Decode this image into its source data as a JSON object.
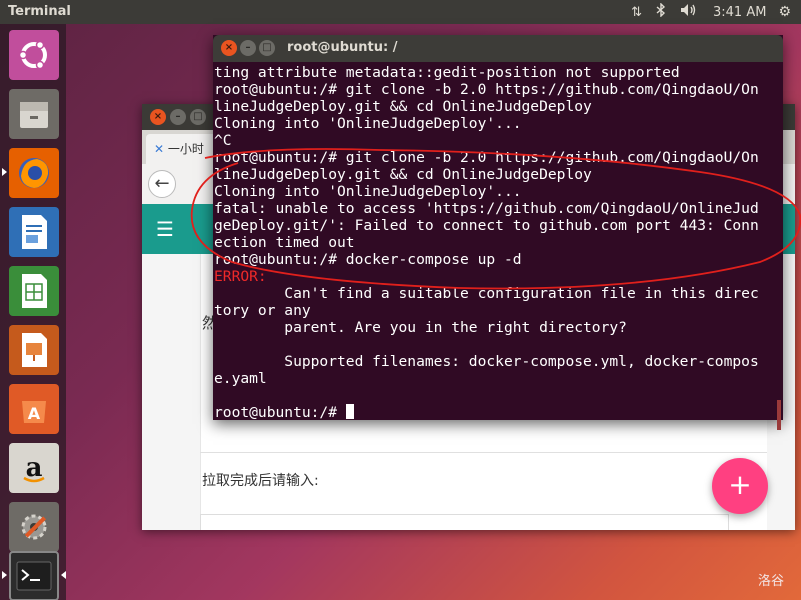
{
  "top_panel": {
    "app_title": "Terminal",
    "clock": "3:41 AM",
    "icons": [
      "network-icon",
      "bluetooth-icon",
      "volume-icon",
      "gear-icon"
    ]
  },
  "launcher": {
    "items": [
      {
        "name": "ubuntu-dash-icon"
      },
      {
        "name": "files-icon"
      },
      {
        "name": "firefox-icon"
      },
      {
        "name": "libreoffice-writer-icon"
      },
      {
        "name": "libreoffice-calc-icon"
      },
      {
        "name": "libreoffice-impress-icon"
      },
      {
        "name": "ubuntu-software-icon"
      },
      {
        "name": "amazon-icon"
      },
      {
        "name": "system-settings-icon"
      },
      {
        "name": "terminal-icon"
      }
    ]
  },
  "browser": {
    "tab_title": "一小时",
    "side_text": "然",
    "pull_text": "拉取完成后请输入:"
  },
  "fab": {
    "label": "+"
  },
  "watermark": "洛谷",
  "terminal": {
    "title": "root@ubuntu: /",
    "lines": [
      {
        "text": "ting attribute metadata::gedit-position not supported",
        "type": "normal"
      },
      {
        "text": "root@ubuntu:/# git clone -b 2.0 https://github.com/QingdaoU/On",
        "type": "normal"
      },
      {
        "text": "lineJudgeDeploy.git && cd OnlineJudgeDeploy",
        "type": "normal"
      },
      {
        "text": "Cloning into 'OnlineJudgeDeploy'...",
        "type": "normal"
      },
      {
        "text": "^C",
        "type": "normal"
      },
      {
        "text": "root@ubuntu:/# git clone -b 2.0 https://github.com/QingdaoU/On",
        "type": "normal"
      },
      {
        "text": "lineJudgeDeploy.git && cd OnlineJudgeDeploy",
        "type": "normal"
      },
      {
        "text": "Cloning into 'OnlineJudgeDeploy'...",
        "type": "normal"
      },
      {
        "text": "fatal: unable to access 'https://github.com/QingdaoU/OnlineJud",
        "type": "normal"
      },
      {
        "text": "geDeploy.git/': Failed to connect to github.com port 443: Conn",
        "type": "normal"
      },
      {
        "text": "ection timed out",
        "type": "normal"
      },
      {
        "text": "root@ubuntu:/# docker-compose up -d",
        "type": "normal"
      },
      {
        "text": "ERROR:",
        "type": "error"
      },
      {
        "text": "        Can't find a suitable configuration file in this direc",
        "type": "normal"
      },
      {
        "text": "tory or any",
        "type": "normal"
      },
      {
        "text": "        parent. Are you in the right directory?",
        "type": "normal"
      },
      {
        "text": "",
        "type": "normal"
      },
      {
        "text": "        Supported filenames: docker-compose.yml, docker-compos",
        "type": "normal"
      },
      {
        "text": "e.yaml",
        "type": "normal"
      },
      {
        "text": "",
        "type": "normal"
      }
    ],
    "prompt": "root@ubuntu:/# "
  },
  "colors": {
    "terminal_bg": "#300a24",
    "error_red": "#ef2929",
    "annotation_red": "#e0201c",
    "fab_pink": "#ff4081",
    "teal_appbar": "#1a9b8d"
  }
}
